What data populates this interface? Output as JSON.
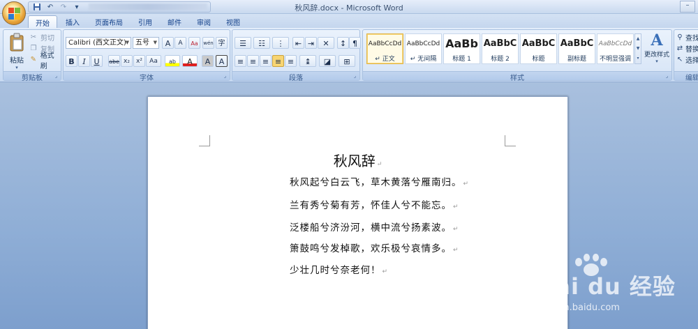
{
  "window": {
    "title": "秋风辞.docx - Microsoft Word"
  },
  "qat": {
    "save_icon": "save-icon",
    "undo_icon": "undo-icon",
    "redo_icon": "redo-icon",
    "customize_icon": "customize-icon"
  },
  "tabs": [
    {
      "label": "开始",
      "active": true
    },
    {
      "label": "插入"
    },
    {
      "label": "页面布局"
    },
    {
      "label": "引用"
    },
    {
      "label": "邮件"
    },
    {
      "label": "审阅"
    },
    {
      "label": "视图"
    }
  ],
  "clipboard": {
    "paste": "粘贴",
    "cut": "剪切",
    "copy": "复制",
    "format_painter": "格式刷",
    "group_label": "剪贴板"
  },
  "font": {
    "font_name": "Calibri (西文正文)",
    "font_size": "五号",
    "group_label": "字体",
    "bold": "B",
    "italic": "I",
    "underline": "U",
    "strike": "abe",
    "subscript": "x₂",
    "superscript": "x²",
    "change_case": "Aa",
    "highlight": "ab",
    "font_color": "A",
    "char_shading": "A",
    "char_border": "A",
    "grow": "A",
    "shrink": "A",
    "clear": "Aa",
    "phonetic": "wén",
    "enclose": "字"
  },
  "paragraph": {
    "group_label": "段落"
  },
  "styles": {
    "group_label": "样式",
    "items": [
      {
        "sample": "AaBbCcDd",
        "name": "↵ 正文",
        "active": true
      },
      {
        "sample": "AaBbCcDd",
        "name": "↵ 无间隔"
      },
      {
        "sample": "AaBb",
        "name": "标题 1"
      },
      {
        "sample": "AaBbC",
        "name": "标题 2"
      },
      {
        "sample": "AaBbC",
        "name": "标题"
      },
      {
        "sample": "AaBbC",
        "name": "副标题"
      },
      {
        "sample": "AaBbCcDd",
        "name": "不明显强调"
      }
    ],
    "change_styles": "更改样式"
  },
  "editing": {
    "group_label": "编辑",
    "find": "查找",
    "replace": "替换",
    "select": "选择"
  },
  "document": {
    "title": "秋风辞",
    "lines": [
      "秋风起兮白云飞，草木黄落兮雁南归。",
      "兰有秀兮菊有芳，怀佳人兮不能忘。",
      "泛楼船兮济汾河，横中流兮扬素波。",
      "箫鼓鸣兮发棹歌，欢乐极兮哀情多。",
      "少壮几时兮奈老何！"
    ],
    "para_mark": "↵"
  },
  "watermark": {
    "text": "Bai du 经验",
    "url": "jingyan.baidu.com"
  },
  "colors": {
    "accent": "#15428b",
    "ribbon": "#d4e3f6",
    "workspace": "#8faed6"
  }
}
